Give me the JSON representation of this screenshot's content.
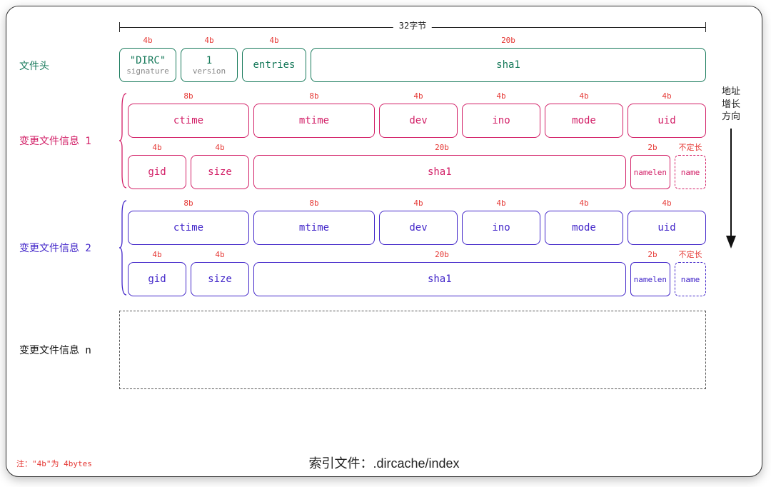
{
  "ruler_label": "32字节",
  "arrow_label_lines": [
    "地址",
    "增长",
    "方向"
  ],
  "header": {
    "label": "文件头",
    "sizes": [
      "4b",
      "4b",
      "4b",
      "20b"
    ],
    "cells": [
      {
        "main": "\"DIRC\"",
        "sub": "signature"
      },
      {
        "main": "1",
        "sub": "version"
      },
      {
        "main": "entries"
      },
      {
        "main": "sha1"
      }
    ]
  },
  "entry1": {
    "label": "变更文件信息 1",
    "row1_sizes": [
      "8b",
      "8b",
      "4b",
      "4b",
      "4b",
      "4b"
    ],
    "row1_cells": [
      "ctime",
      "mtime",
      "dev",
      "ino",
      "mode",
      "uid"
    ],
    "row2_sizes": [
      "4b",
      "4b",
      "20b",
      "2b",
      "不定长"
    ],
    "row2_cells": [
      "gid",
      "size",
      "sha1",
      "namelen",
      "name"
    ]
  },
  "entry2": {
    "label": "变更文件信息 2",
    "row1_sizes": [
      "8b",
      "8b",
      "4b",
      "4b",
      "4b",
      "4b"
    ],
    "row1_cells": [
      "ctime",
      "mtime",
      "dev",
      "ino",
      "mode",
      "uid"
    ],
    "row2_sizes": [
      "4b",
      "4b",
      "20b",
      "2b",
      "不定长"
    ],
    "row2_cells": [
      "gid",
      "size",
      "sha1",
      "namelen",
      "name"
    ]
  },
  "entryN": {
    "label": "变更文件信息 n"
  },
  "footnote": "注：\"4b\"为 4bytes",
  "caption": "索引文件：.dircache/index"
}
